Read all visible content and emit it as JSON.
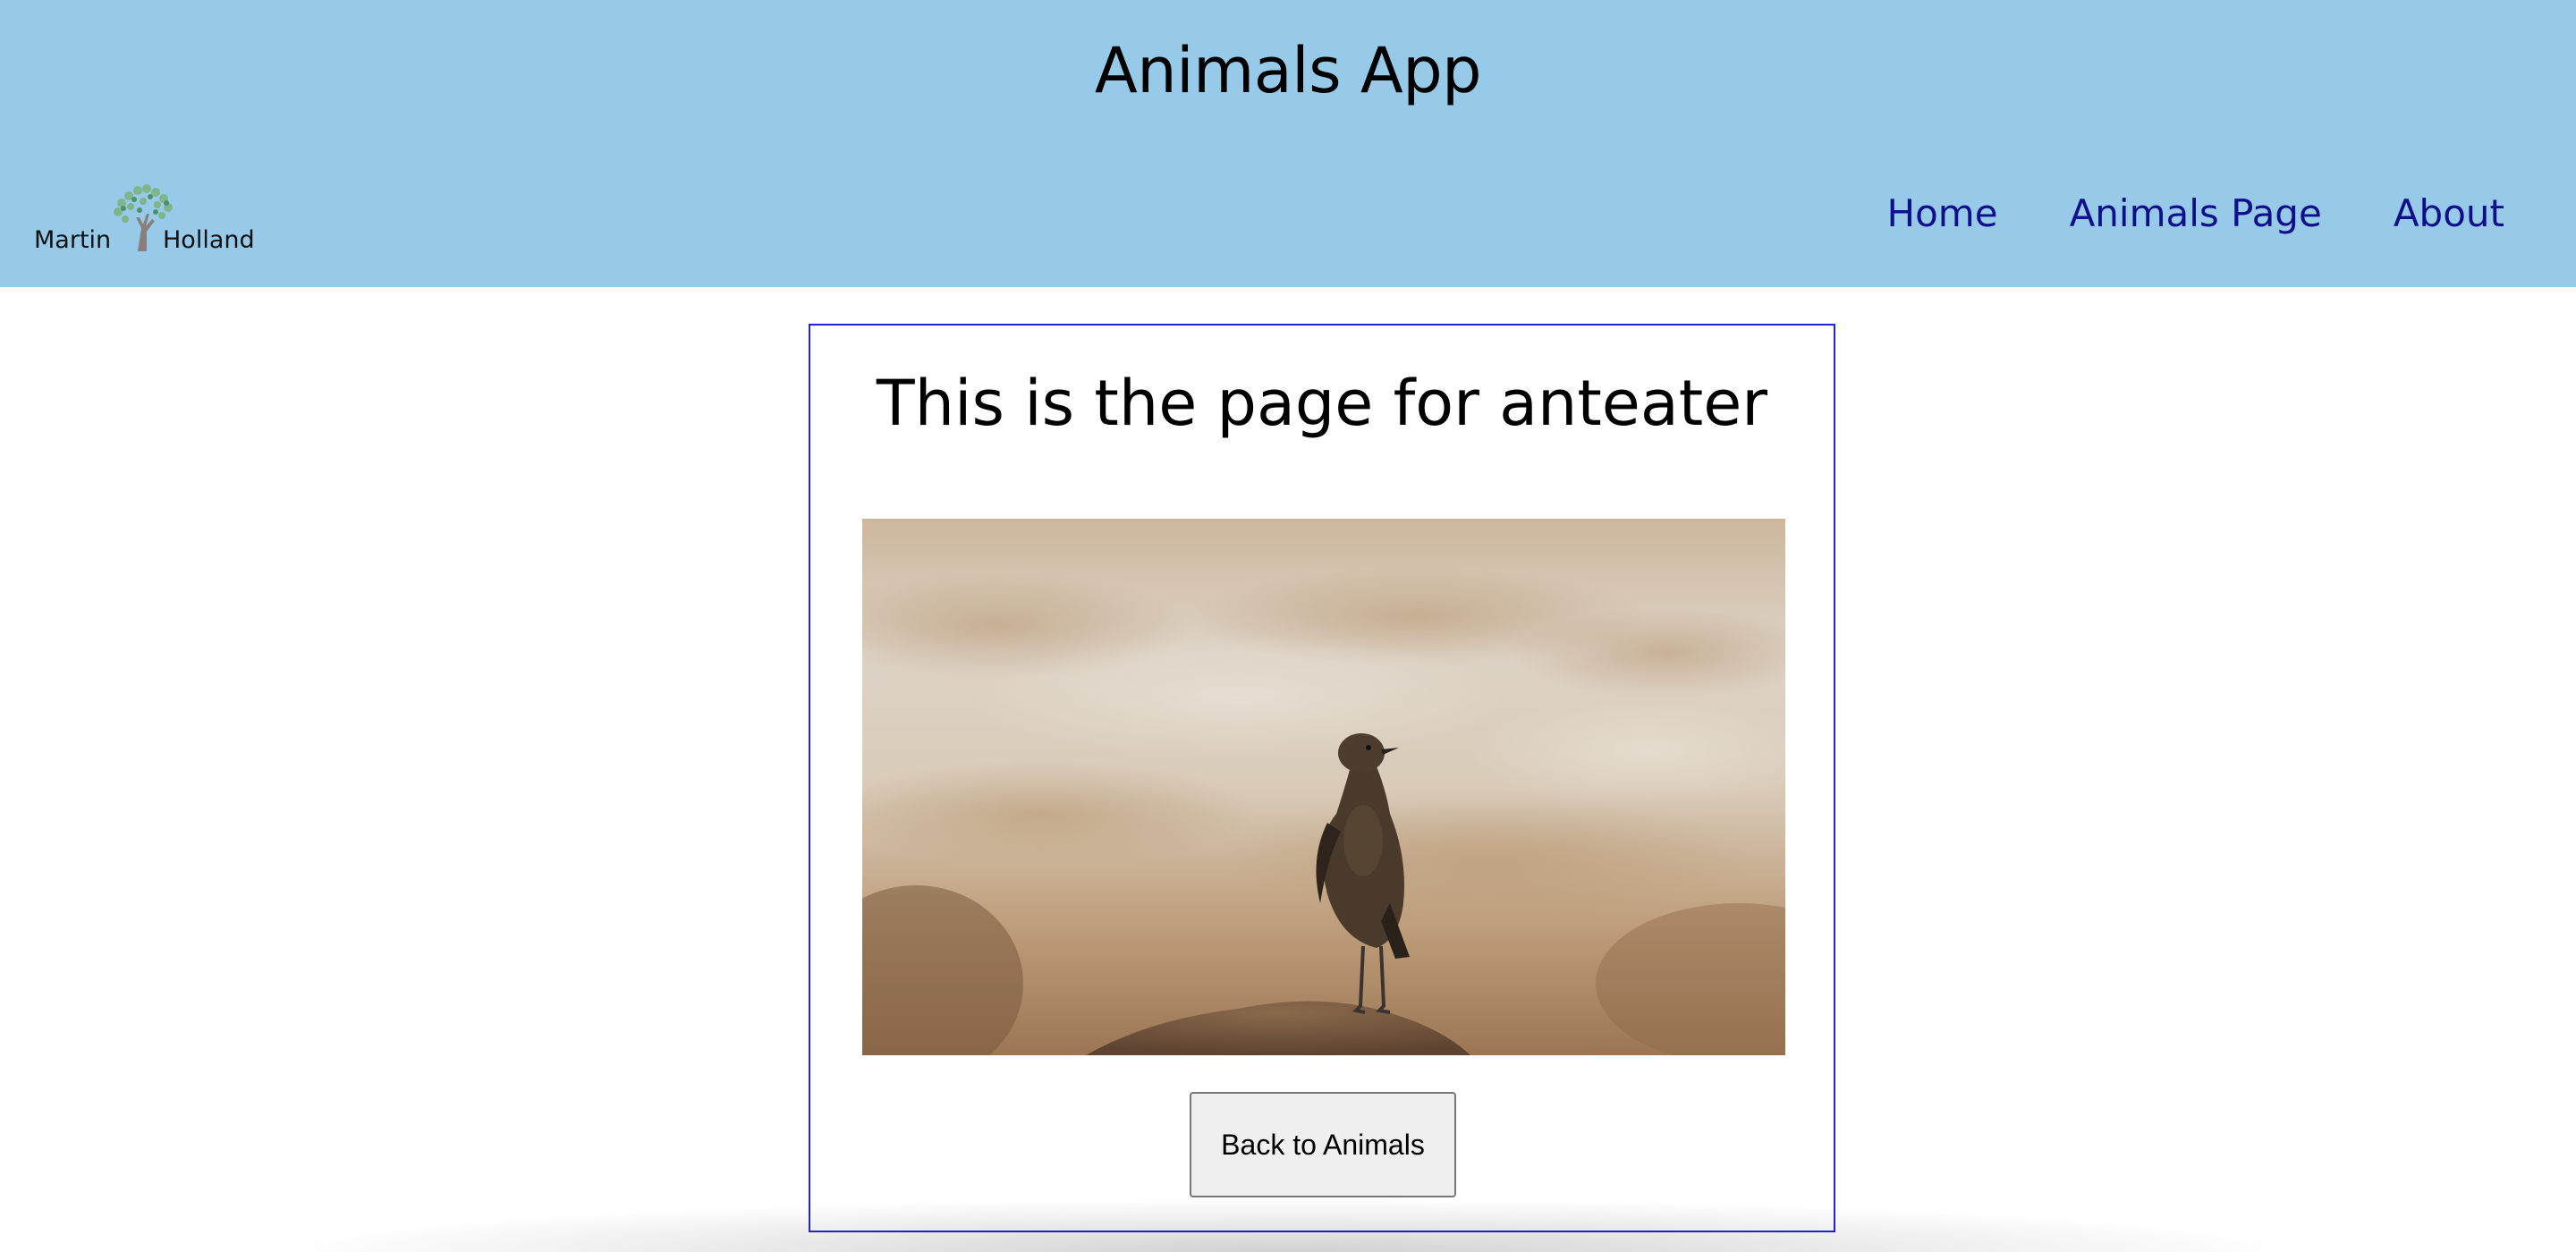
{
  "header": {
    "title": "Animals App",
    "background_color": "#97cae8",
    "logo": {
      "first_name": "Martin",
      "last_name": "Holland",
      "icon": "tree-icon"
    },
    "nav": [
      {
        "label": "Home"
      },
      {
        "label": "Animals Page"
      },
      {
        "label": "About"
      }
    ],
    "nav_color": "#0f0f8c"
  },
  "main": {
    "heading": "This is the page for anteater",
    "image": {
      "subject": "bird-photo"
    },
    "back_button_label": "Back to Animals",
    "card_border_color": "#2323d6"
  }
}
